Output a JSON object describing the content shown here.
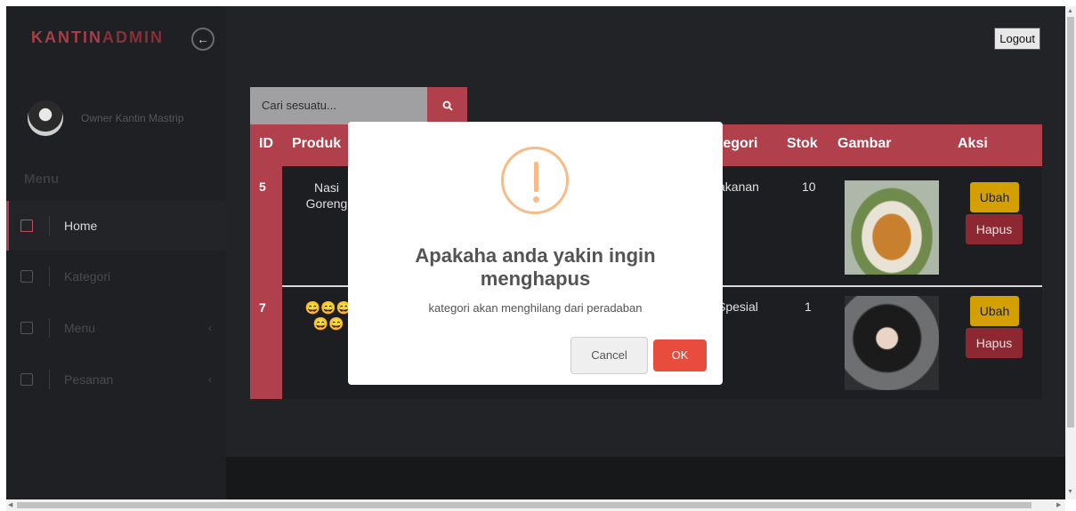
{
  "sidebar": {
    "brand_a": "KANTIN",
    "brand_b": "ADMIN",
    "toggle_icon": "←",
    "owner": "Owner Kantin Mastrip",
    "menu_heading": "Menu",
    "items": [
      {
        "label": "Home",
        "active": true
      },
      {
        "label": "Kategori",
        "active": false
      },
      {
        "label": "Menu",
        "active": false,
        "chevron": "‹"
      },
      {
        "label": "Pesanan",
        "active": false,
        "chevron": "‹"
      }
    ]
  },
  "header": {
    "logout_label": "Logout"
  },
  "search": {
    "placeholder": "Cari sesuatu...",
    "icon": "search-icon"
  },
  "table": {
    "headers": [
      "ID",
      "Produk",
      "Kategori",
      "Stok",
      "Gambar",
      "Aksi"
    ],
    "visible_header_kategori": "tegori",
    "rows": [
      {
        "id": "5",
        "produk": "Nasi Goreng",
        "kategori": "akanan",
        "stok": "10",
        "ubah": "Ubah",
        "hapus": "Hapus"
      },
      {
        "id": "7",
        "produk": "😄😄😄 😄😄",
        "kategori": "Spesial",
        "stok": "1",
        "ubah": "Ubah",
        "hapus": "Hapus"
      }
    ]
  },
  "modal": {
    "title": "Apakaha anda yakin ingin menghapus",
    "text": "kategori akan menghilang dari peradaban",
    "cancel_label": "Cancel",
    "ok_label": "OK",
    "warning_color": "#f8bb86",
    "ok_color": "#e74c3c"
  },
  "colors": {
    "accent": "#b0404b",
    "background": "#222327"
  }
}
